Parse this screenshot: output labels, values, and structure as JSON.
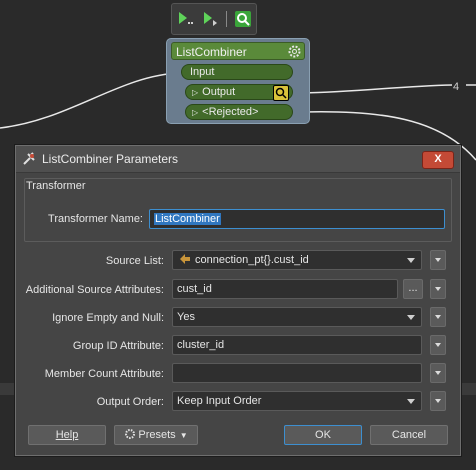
{
  "canvas": {
    "connection_count": "4"
  },
  "node": {
    "title": "ListCombiner",
    "ports": {
      "input": "Input",
      "output": "Output",
      "rejected": "<Rejected>"
    }
  },
  "dialog": {
    "title": "ListCombiner Parameters",
    "close_label": "X",
    "group_label": "Transformer",
    "transformer_name_label": "Transformer Name:",
    "transformer_name_value": "ListCombiner",
    "source_list_label": "Source List:",
    "source_list_value": "connection_pt{}.cust_id",
    "additional_attrs_label": "Additional Source Attributes:",
    "additional_attrs_value": "cust_id",
    "ellipsis_label": "...",
    "ignore_empty_label": "Ignore Empty and Null:",
    "ignore_empty_value": "Yes",
    "group_id_label": "Group ID Attribute:",
    "group_id_value": "cluster_id",
    "member_count_label": "Member Count Attribute:",
    "member_count_value": "",
    "output_order_label": "Output Order:",
    "output_order_value": "Keep Input Order",
    "buttons": {
      "help": "Help",
      "presets": "Presets",
      "ok": "OK",
      "cancel": "Cancel"
    }
  },
  "colors": {
    "node_title": "#5a8a3a",
    "port": "#426a2a",
    "focus": "#3d8fd0",
    "close": "#c44a36"
  }
}
